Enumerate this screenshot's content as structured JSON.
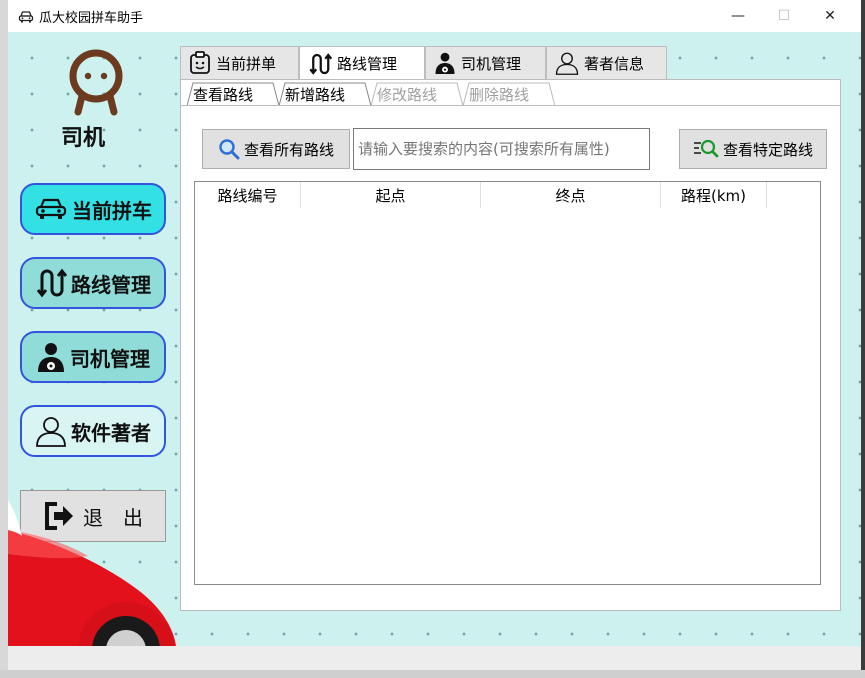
{
  "window": {
    "title": "瓜大校园拼车助手",
    "minimize_glyph": "—",
    "maximize_glyph": "☐",
    "close_glyph": "✕"
  },
  "sidebar": {
    "avatar_icon": "driver-face-icon",
    "role_label": "司机",
    "items": [
      {
        "label": "当前拼车",
        "icon": "car-icon",
        "bg": "#33e0e4"
      },
      {
        "label": "路线管理",
        "icon": "route-icon",
        "bg": "#8fdcd8"
      },
      {
        "label": "司机管理",
        "icon": "driver-icon",
        "bg": "#8fdcd8"
      },
      {
        "label": "软件著者",
        "icon": "person-icon",
        "bg": "#d8f5f3"
      }
    ],
    "exit_label": "退　出",
    "exit_icon": "exit-icon"
  },
  "tabs": [
    {
      "label": "当前拼单",
      "icon": "clipboard-icon"
    },
    {
      "label": "路线管理",
      "icon": "route-icon"
    },
    {
      "label": "司机管理",
      "icon": "driver-icon"
    },
    {
      "label": "著者信息",
      "icon": "person-icon"
    }
  ],
  "active_tab": "路线管理",
  "subtabs": [
    {
      "label": "查看路线",
      "state": "active"
    },
    {
      "label": "新增路线",
      "state": "normal"
    },
    {
      "label": "修改路线",
      "state": "disabled"
    },
    {
      "label": "删除路线",
      "state": "disabled"
    }
  ],
  "toolbar": {
    "view_all_label": "查看所有路线",
    "search_placeholder": "请输入要搜索的内容(可搜索所有属性)",
    "view_specific_label": "查看特定路线"
  },
  "table": {
    "columns": [
      "路线编号",
      "起点",
      "终点",
      "路程(km)"
    ],
    "rows": []
  },
  "colors": {
    "window_bg": "#cdf1ef",
    "accent_border": "#3355dd",
    "active_button": "#33e0e4"
  }
}
